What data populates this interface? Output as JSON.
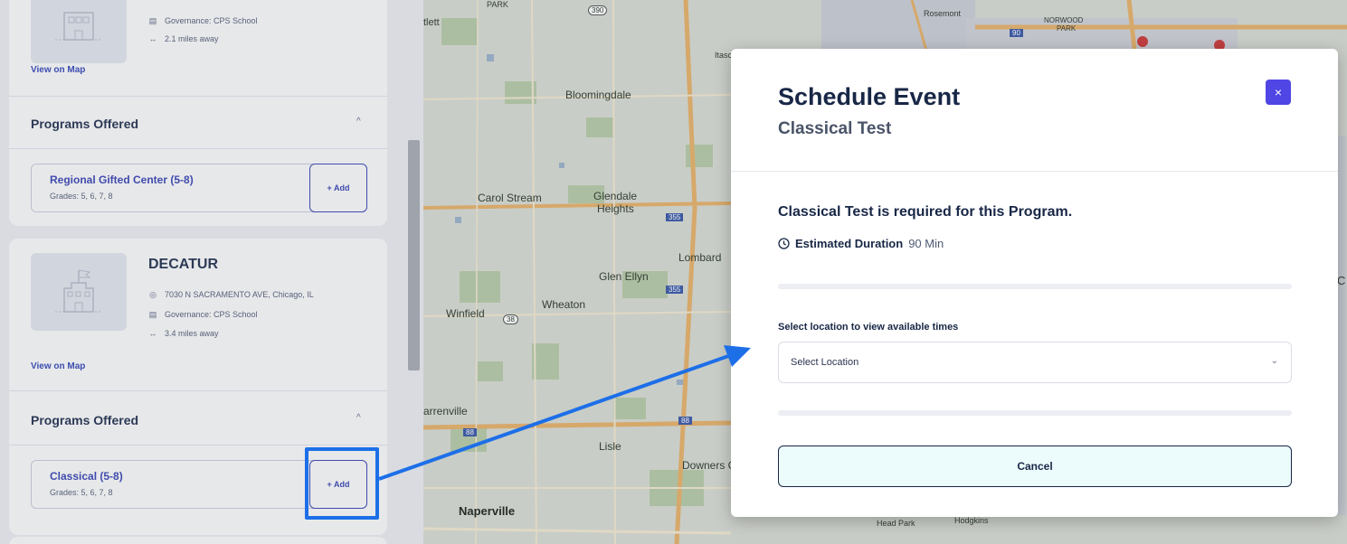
{
  "left_panel": {
    "top_school": {
      "governance": "Governance: CPS School",
      "distance": "2.1 miles away",
      "view_on_map": "View on Map",
      "programs_header": "Programs Offered",
      "program": {
        "name": "Regional Gifted Center (5-8)",
        "grades": "Grades: 5, 6, 7, 8",
        "add_label": "+ Add"
      }
    },
    "decatur": {
      "name": "DECATUR",
      "address": "7030 N SACRAMENTO AVE, Chicago, IL",
      "governance": "Governance: CPS School",
      "distance": "3.4 miles away",
      "view_on_map": "View on Map",
      "programs_header": "Programs Offered",
      "program": {
        "name": "Classical (5-8)",
        "grades": "Grades: 5, 6, 7, 8",
        "add_label": "+ Add"
      }
    }
  },
  "map": {
    "labels": [
      "PARK",
      "tlett",
      "Bloomingdale",
      "Itasc",
      "Rosemont",
      "NORWOOD",
      "PARK",
      "Carol Stream",
      "Glendale",
      "Heights",
      "Lombard",
      "Glen Ellyn",
      "Wheaton",
      "Winfield",
      "arrenville",
      "Lisle",
      "Downers G",
      "Naperville",
      "Head Park",
      "Hodgkins",
      "C"
    ],
    "shields": [
      "390",
      "355",
      "355",
      "38",
      "88",
      "88",
      "90"
    ]
  },
  "modal": {
    "title": "Schedule Event",
    "subtitle": "Classical Test",
    "close_label": "×",
    "required_text": "Classical Test is required for this Program.",
    "duration_label": "Estimated Duration",
    "duration_value": "90 Min",
    "select_label": "Select location to view available times",
    "select_value": "Select Location",
    "cancel_label": "Cancel"
  },
  "colors": {
    "accent": "#4f46e5",
    "link": "#3440b4",
    "annotation": "#1d6fe8",
    "cancel_bg": "#ecfbfb"
  }
}
